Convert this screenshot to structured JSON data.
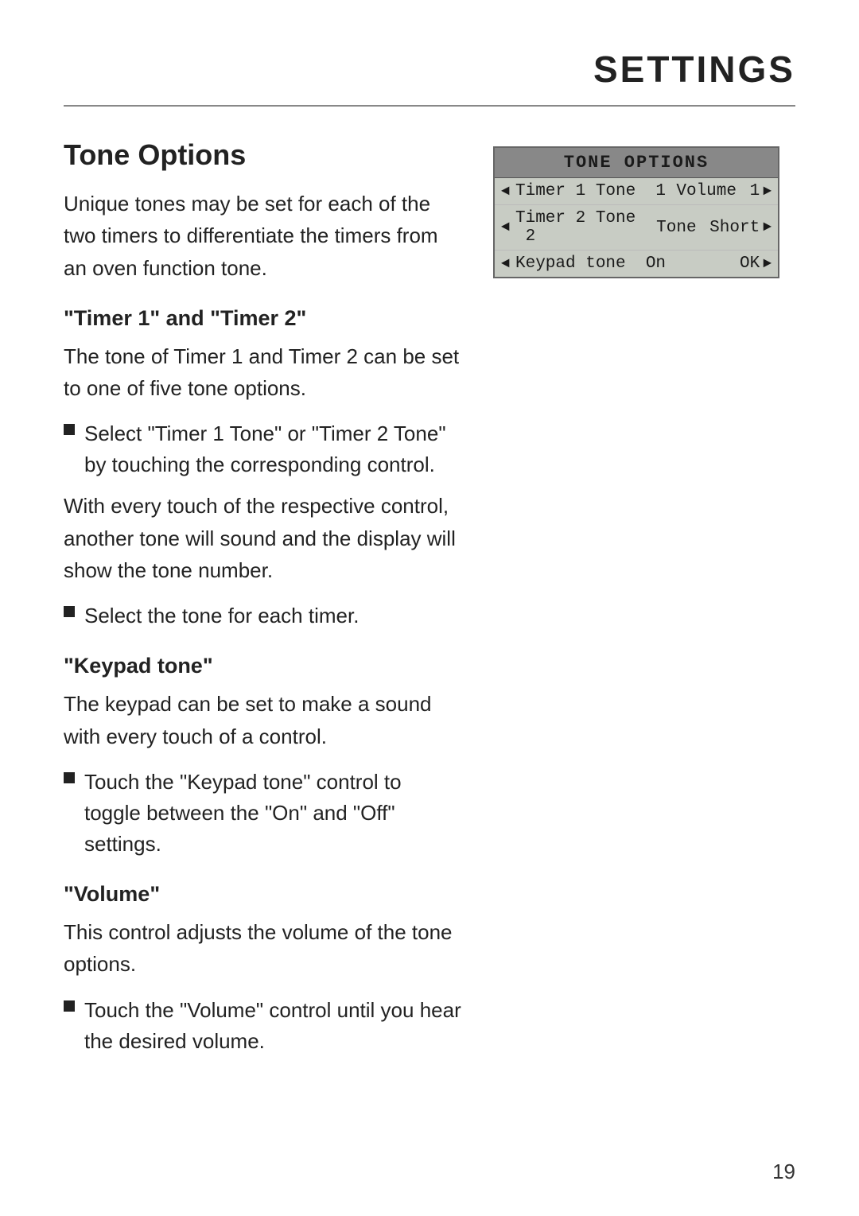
{
  "header": {
    "title": "SETTINGS",
    "divider": true
  },
  "section": {
    "title": "Tone Options",
    "intro": "Unique tones may be set for each of the two timers to differentiate the timers from an oven function tone.",
    "subsections": [
      {
        "id": "timer",
        "title": "\"Timer 1\" and \"Timer 2\"",
        "description": "The tone of Timer 1 and Timer 2 can be set to one of five tone options.",
        "bullets": [
          "Select \"Timer 1 Tone\" or \"Timer 2 Tone\" by touching the corresponding control."
        ]
      },
      {
        "id": "between",
        "description": "With every touch of the respective control, another tone will sound and the display will show the tone number.",
        "bullets": [
          "Select the tone for each timer."
        ]
      },
      {
        "id": "keypad",
        "title": "\"Keypad tone\"",
        "description": "The keypad can be set to make a sound with every touch of a control.",
        "bullets": [
          "Touch the \"Keypad tone\" control to toggle between the \"On\" and \"Off\" settings."
        ]
      },
      {
        "id": "volume",
        "title": "\"Volume\"",
        "description": "This control adjusts the volume of the tone options.",
        "bullets": [
          "Touch the \"Volume\" control until you hear the desired volume."
        ]
      }
    ]
  },
  "lcd": {
    "header": "TONE OPTIONS",
    "rows": [
      {
        "arrow_left": "◄",
        "label": "Timer 1 Tone",
        "value": "1",
        "attr": "Volume",
        "attr_val": "1",
        "arrow_right": "►"
      },
      {
        "arrow_left": "◄",
        "label": "Timer 2 Tone",
        "value": "2",
        "attr": "Tone",
        "attr_val": "Short",
        "arrow_right": "►"
      },
      {
        "arrow_left": "◄",
        "label": "Keypad tone",
        "value": "On",
        "attr": "",
        "attr_val": "OK",
        "arrow_right": "►"
      }
    ]
  },
  "page_number": "19"
}
